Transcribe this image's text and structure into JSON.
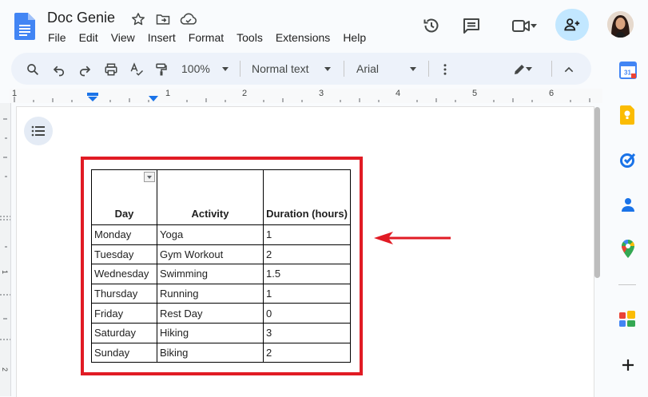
{
  "document": {
    "title": "Doc Genie"
  },
  "menu": [
    "File",
    "Edit",
    "View",
    "Insert",
    "Format",
    "Tools",
    "Extensions",
    "Help"
  ],
  "toolbar": {
    "zoom": "100%",
    "style": "Normal text",
    "font": "Arial"
  },
  "ruler": {
    "numbers": [
      "1",
      "1",
      "2",
      "3",
      "4",
      "5",
      "6"
    ]
  },
  "left_ruler": {
    "numbers": [
      "1",
      "2"
    ]
  },
  "table": {
    "headers": [
      "Day",
      "Activity",
      "Duration (hours)"
    ],
    "rows": [
      [
        "Monday",
        "Yoga",
        "1"
      ],
      [
        "Tuesday",
        "Gym Workout",
        "2"
      ],
      [
        "Wednesday",
        "Swimming",
        "1.5"
      ],
      [
        "Thursday",
        "Running",
        "1"
      ],
      [
        "Friday",
        "Rest Day",
        "0"
      ],
      [
        "Saturday",
        "Hiking",
        "3"
      ],
      [
        "Sunday",
        "Biking",
        "2"
      ]
    ]
  },
  "icons": {
    "doc": "google-docs-icon",
    "star": "star-icon",
    "move": "move-to-folder-icon",
    "cloud": "cloud-saved-icon",
    "history": "history-icon",
    "comments": "comments-icon",
    "meet": "video-call-icon",
    "share": "add-person-icon"
  },
  "colors": {
    "highlight": "#e11b24",
    "toolbar_bg": "#edf2fa",
    "share_bg": "#c2e7ff",
    "doc_blue": "#4285f4"
  },
  "calendar_day": "31"
}
